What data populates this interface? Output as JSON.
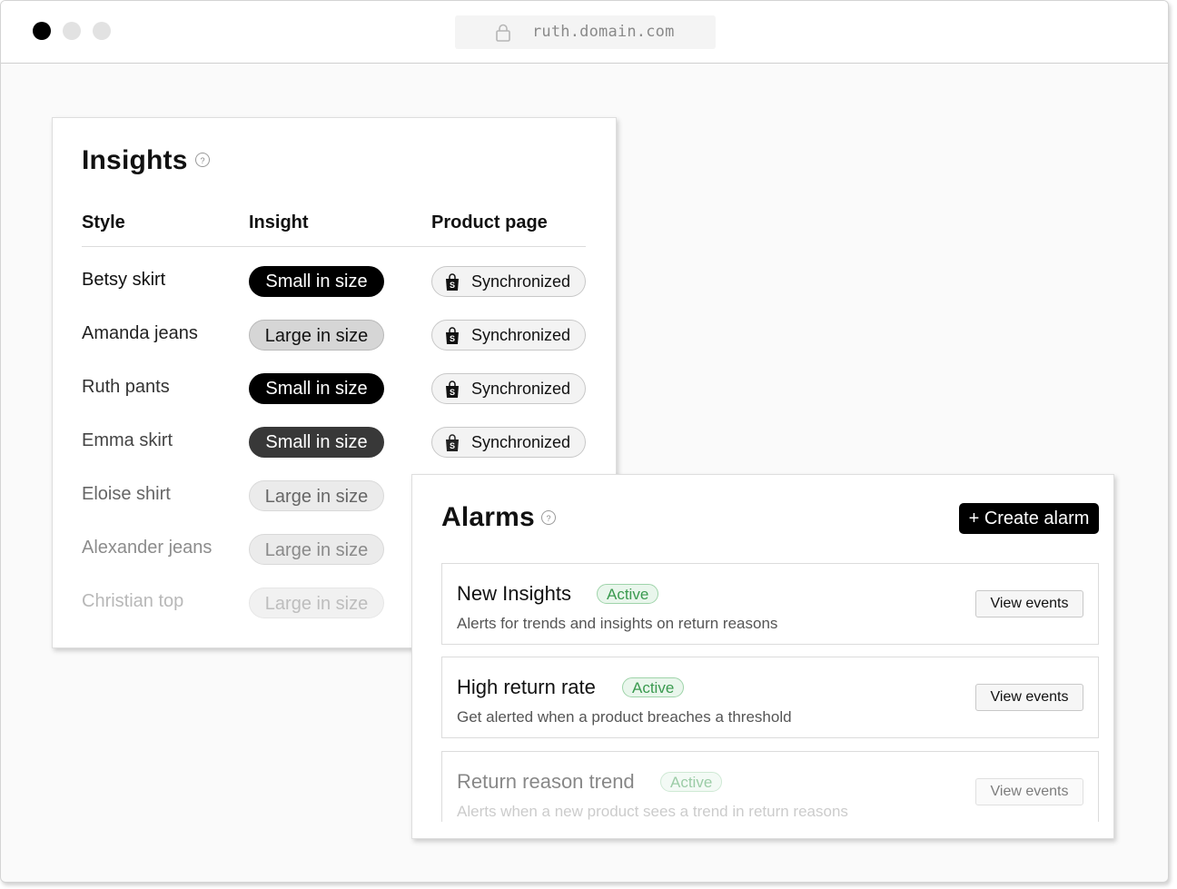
{
  "browser": {
    "url": "ruth.domain.com"
  },
  "insights": {
    "title": "Insights",
    "help": "?",
    "columns": {
      "style": "Style",
      "insight": "Insight",
      "product_page": "Product page"
    },
    "rows": [
      {
        "style": "Betsy skirt",
        "insight": "Small in size",
        "product_page": "Synchronized"
      },
      {
        "style": "Amanda jeans",
        "insight": "Large in size",
        "product_page": "Synchronized"
      },
      {
        "style": "Ruth pants",
        "insight": "Small in size",
        "product_page": "Synchronized"
      },
      {
        "style": "Emma skirt",
        "insight": "Small in size",
        "product_page": "Synchronized"
      },
      {
        "style": "Eloise shirt",
        "insight": "Large in size"
      },
      {
        "style": "Alexander jeans",
        "insight": "Large in size"
      },
      {
        "style": "Christian top",
        "insight": "Large in size"
      }
    ]
  },
  "alarms": {
    "title": "Alarms",
    "help": "?",
    "create_label": "+ Create alarm",
    "items": [
      {
        "name": "New Insights",
        "status": "Active",
        "description": "Alerts for trends and insights on return reasons",
        "action": "View events"
      },
      {
        "name": "High return rate",
        "status": "Active",
        "description": "Get alerted when a product breaches a threshold",
        "action": "View events"
      },
      {
        "name": "Return reason trend",
        "status": "Active",
        "description": "Alerts when a new product sees a trend in return reasons",
        "action": "View events"
      }
    ]
  },
  "colors": {
    "accent": "#000000",
    "active_badge": "#3a9a4f"
  },
  "icons": [
    "lock-icon",
    "shopify-bag-icon",
    "help-icon"
  ]
}
